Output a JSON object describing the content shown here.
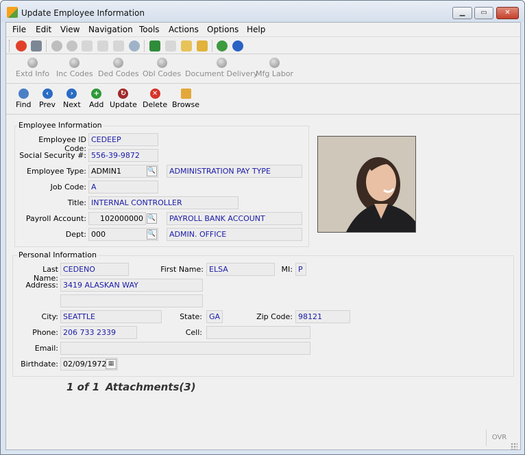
{
  "window": {
    "title": "Update Employee Information"
  },
  "menu": [
    "File",
    "Edit",
    "View",
    "Navigation",
    "Tools",
    "Actions",
    "Options",
    "Help"
  ],
  "toolbar_links": [
    "Extd Info",
    "Inc Codes",
    "Ded Codes",
    "Obl Codes",
    "Document Delivery",
    "Mfg Labor"
  ],
  "toolbar_actions": [
    "Find",
    "Prev",
    "Next",
    "Add",
    "Update",
    "Delete",
    "Browse"
  ],
  "employee_info": {
    "section_title": "Employee Information",
    "employee_id_label": "Employee ID Code:",
    "employee_id": "CEDEEP",
    "ssn_label": "Social Security #:",
    "ssn": "556-39-9872",
    "type_label": "Employee Type:",
    "type_code": "ADMIN1",
    "type_desc": "ADMINISTRATION PAY TYPE",
    "job_code_label": "Job Code:",
    "job_code": "A",
    "title_label": "Title:",
    "title": "INTERNAL CONTROLLER",
    "payroll_label": "Payroll Account:",
    "payroll_account": "102000000",
    "payroll_desc": "PAYROLL BANK ACCOUNT",
    "dept_label": "Dept:",
    "dept_code": "000",
    "dept_desc": "ADMIN. OFFICE"
  },
  "personal_info": {
    "section_title": "Personal Information",
    "last_name_label": "Last Name:",
    "last_name": "CEDENO",
    "first_name_label": "First Name:",
    "first_name": "ELSA",
    "mi_label": "MI:",
    "mi": "P",
    "address_label": "Address:",
    "address1": "3419 ALASKAN WAY",
    "address2": "",
    "city_label": "City:",
    "city": "SEATTLE",
    "state_label": "State:",
    "state": "GA",
    "zip_label": "Zip Code:",
    "zip": "98121",
    "phone_label": "Phone:",
    "phone": "206 733 2339",
    "cell_label": "Cell:",
    "cell": "",
    "email_label": "Email:",
    "email": "",
    "birthdate_label": "Birthdate:",
    "birthdate": "02/09/1972"
  },
  "footer": {
    "record_count": "1 of 1",
    "attachments": "Attachments(3)",
    "status_ovr": "OVR"
  }
}
